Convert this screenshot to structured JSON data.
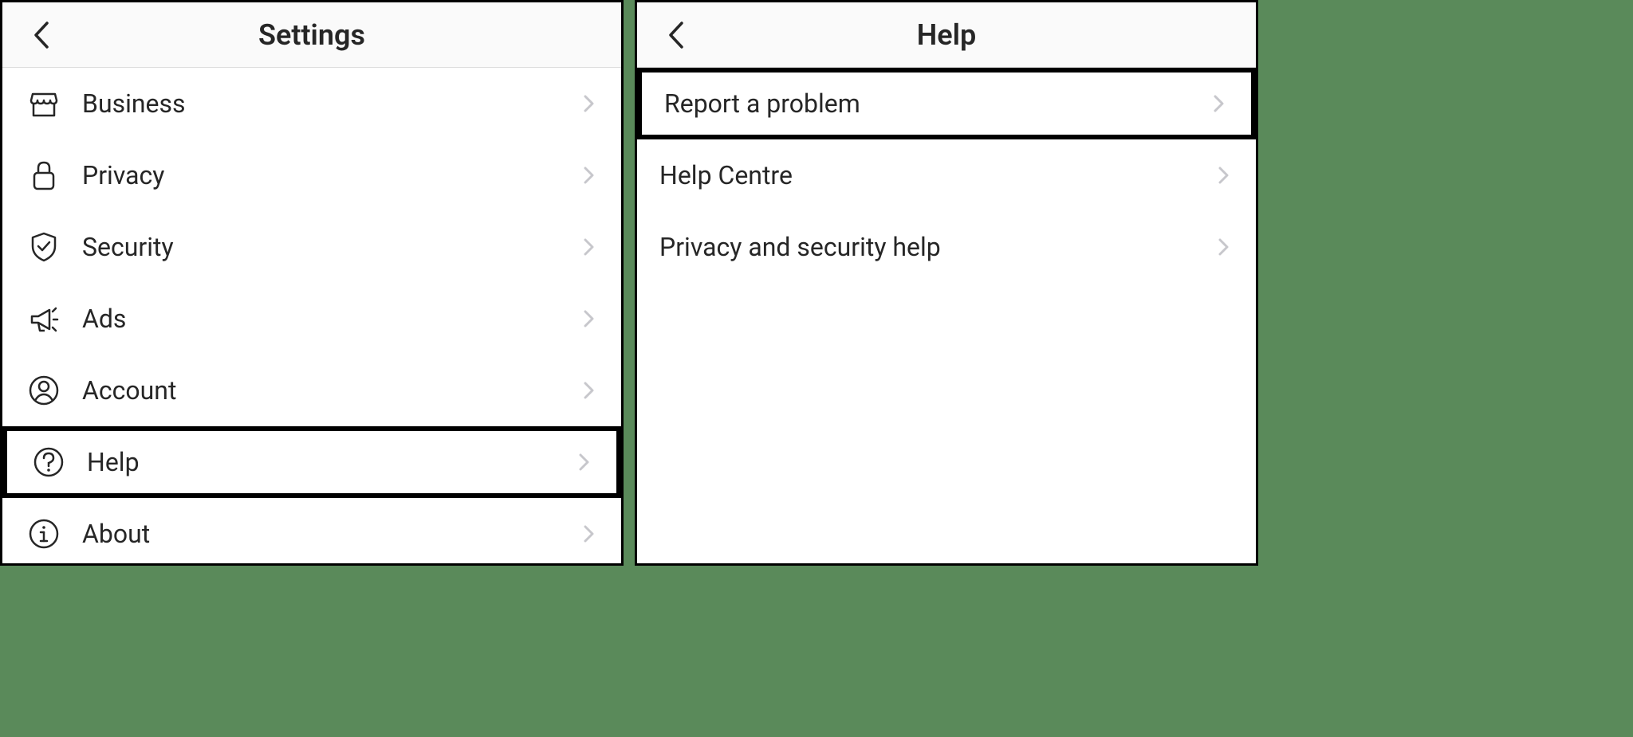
{
  "settings": {
    "title": "Settings",
    "items": [
      {
        "label": "Business",
        "icon": "storefront-icon"
      },
      {
        "label": "Privacy",
        "icon": "lock-icon"
      },
      {
        "label": "Security",
        "icon": "shield-icon"
      },
      {
        "label": "Ads",
        "icon": "megaphone-icon"
      },
      {
        "label": "Account",
        "icon": "person-icon"
      },
      {
        "label": "Help",
        "icon": "question-icon",
        "highlighted": true
      },
      {
        "label": "About",
        "icon": "info-icon"
      }
    ]
  },
  "help": {
    "title": "Help",
    "items": [
      {
        "label": "Report a problem",
        "highlighted": true
      },
      {
        "label": "Help Centre"
      },
      {
        "label": "Privacy and security help"
      }
    ]
  }
}
